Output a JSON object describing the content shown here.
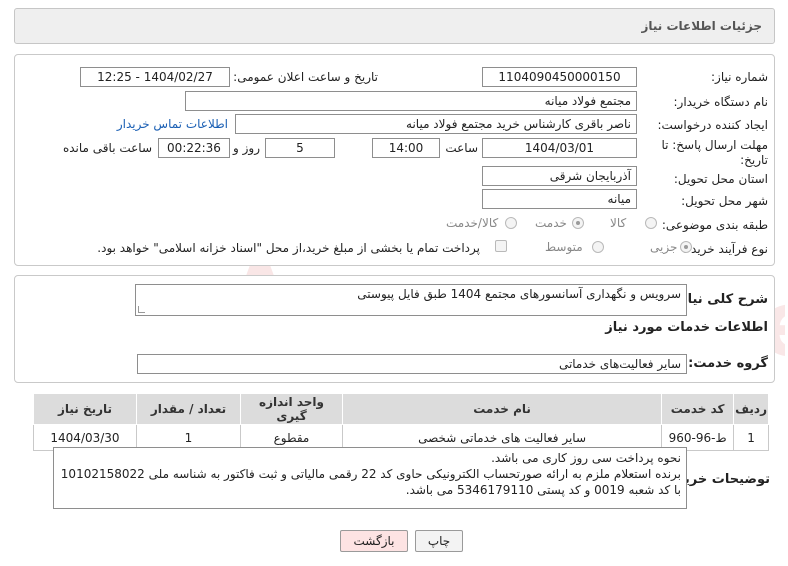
{
  "header": {
    "title": "جزئیات اطلاعات نیاز"
  },
  "form": {
    "need_number_label": "شماره نیاز:",
    "need_number": "1104090450000150",
    "announce_label": "تاریخ و ساعت اعلان عمومی:",
    "announce_value": "1404/02/27 - 12:25",
    "buyer_label": "نام دستگاه خریدار:",
    "buyer_value": "مجتمع فولاد میانه",
    "creator_label": "ایجاد کننده درخواست:",
    "creator_value": "ناصر باقری کارشناس خرید مجتمع فولاد میانه",
    "contact_link": "اطلاعات تماس خریدار",
    "deadline_label_1": "مهلت ارسال پاسخ: تا",
    "deadline_label_2": "تاریخ:",
    "deadline_date": "1404/03/01",
    "hour_label": "ساعت",
    "deadline_time": "14:00",
    "days_value": "5",
    "days_label": "روز و",
    "remaining_value": "00:22:36",
    "remaining_label": "ساعت باقی مانده",
    "province_label": "استان محل تحویل:",
    "province_value": "آذربایجان شرقی",
    "city_label": "شهر محل تحویل:",
    "city_value": "میانه",
    "category_label": "طبقه بندی موضوعی:",
    "category_options": [
      "کالا",
      "خدمت",
      "کالا/خدمت"
    ],
    "category_selected": "خدمت",
    "process_label": "نوع فرآیند خرید :",
    "process_options": [
      "جزیی",
      "متوسط"
    ],
    "process_selected": "جزیی",
    "treasury_note": "پرداخت تمام یا بخشی از مبلغ خرید،از محل \"اسناد خزانه اسلامی\" خواهد بود."
  },
  "summary": {
    "label": "شرح کلی نیاز:",
    "value": "سرویس و نگهداری آسانسورهای مجتمع 1404 طبق فایل پیوستی"
  },
  "services": {
    "section_title": "اطلاعات خدمات مورد نیاز",
    "group_label": "گروه خدمت:",
    "group_value": "سایر فعالیت‌های خدماتی",
    "columns": [
      "ردیف",
      "کد خدمت",
      "نام خدمت",
      "واحد اندازه گیری",
      "تعداد / مقدار",
      "تاریخ نیاز"
    ],
    "rows": [
      [
        "1",
        "ط-96-960",
        "سایر فعالیت های خدماتی شخصی",
        "مقطوع",
        "1",
        "1404/03/30"
      ]
    ]
  },
  "buyer_notes": {
    "label": "توضیحات خریدار:",
    "line1": "نحوه پرداخت سی روز کاری می باشد.",
    "line2": "برنده استعلام ملزم به ارائه صورتحساب الکترونیکی حاوی کد 22 رقمی مالیاتی و ثبت فاکتور به شناسه ملی 10102158022",
    "line3": "با کد شعبه 0019 و کد پستی 5346179110 می باشد."
  },
  "buttons": {
    "print": "چاپ",
    "back": "بازگشت"
  },
  "watermark": {
    "text": "AriaTender.neT"
  },
  "colors": {
    "link": "#1a5fb4",
    "header_bg": "#efefef",
    "back_button": "#fde3e3",
    "watermark": "#e07a7a"
  }
}
